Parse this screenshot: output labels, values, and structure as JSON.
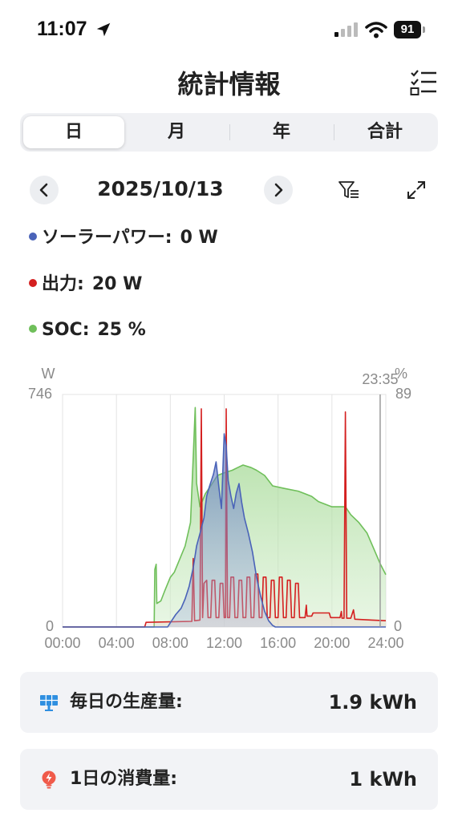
{
  "status_bar": {
    "time": "11:07",
    "battery": "91"
  },
  "header": {
    "title": "統計情報"
  },
  "tabs": [
    {
      "label": "日",
      "active": true
    },
    {
      "label": "月",
      "active": false
    },
    {
      "label": "年",
      "active": false
    },
    {
      "label": "合計",
      "active": false
    }
  ],
  "date_nav": {
    "date": "2025/10/13"
  },
  "legend": [
    {
      "label": "ソーラーパワー:",
      "value": "0 W",
      "color": "#4a63b8"
    },
    {
      "label": "出力:",
      "value": "20 W",
      "color": "#d42020"
    },
    {
      "label": "SOC:",
      "value": "25 %",
      "color": "#6fbf5a"
    }
  ],
  "chart_data": {
    "type": "area",
    "left_axis": {
      "unit": "W",
      "max_label": "746",
      "min_label": "0",
      "range": [
        0,
        746
      ]
    },
    "right_axis": {
      "unit": "%",
      "max_label": "89",
      "min_label": "0",
      "range": [
        0,
        89
      ]
    },
    "x_ticks": [
      "00:00",
      "04:00",
      "08:00",
      "12:00",
      "16:00",
      "20:00",
      "24:00"
    ],
    "x_range_hours": [
      0,
      24
    ],
    "cursor": {
      "label": "23:35",
      "hour": 23.58
    },
    "series": [
      {
        "name": "SOC",
        "axis": "right",
        "color": "#6fbf5a",
        "points": [
          [
            0,
            0
          ],
          [
            6.8,
            0
          ],
          [
            6.85,
            22
          ],
          [
            6.95,
            24
          ],
          [
            7.0,
            9
          ],
          [
            7.3,
            10
          ],
          [
            7.6,
            14
          ],
          [
            8.0,
            19
          ],
          [
            8.3,
            21
          ],
          [
            8.7,
            26
          ],
          [
            9.1,
            31
          ],
          [
            9.5,
            40
          ],
          [
            9.7,
            65
          ],
          [
            9.85,
            84
          ],
          [
            9.95,
            55
          ],
          [
            10.2,
            46
          ],
          [
            10.6,
            51
          ],
          [
            11.0,
            54
          ],
          [
            11.5,
            58
          ],
          [
            12.0,
            59
          ],
          [
            12.6,
            60
          ],
          [
            13.0,
            61
          ],
          [
            13.4,
            62
          ],
          [
            14.0,
            61
          ],
          [
            14.4,
            60
          ],
          [
            15.0,
            58
          ],
          [
            15.6,
            54
          ],
          [
            16.5,
            53
          ],
          [
            17.5,
            52
          ],
          [
            18.5,
            50
          ],
          [
            19.0,
            48
          ],
          [
            20.0,
            46
          ],
          [
            21.0,
            46
          ],
          [
            21.4,
            43
          ],
          [
            22.0,
            40
          ],
          [
            22.6,
            36
          ],
          [
            23.1,
            30
          ],
          [
            23.6,
            24
          ],
          [
            24,
            20
          ]
        ]
      },
      {
        "name": "ソーラーパワー",
        "axis": "left",
        "color": "#4a63b8",
        "points": [
          [
            0,
            0
          ],
          [
            7.8,
            0
          ],
          [
            8.1,
            20
          ],
          [
            8.4,
            40
          ],
          [
            8.8,
            60
          ],
          [
            9.1,
            90
          ],
          [
            9.4,
            130
          ],
          [
            9.7,
            190
          ],
          [
            9.95,
            260
          ],
          [
            10.2,
            300
          ],
          [
            10.5,
            350
          ],
          [
            10.7,
            420
          ],
          [
            10.9,
            450
          ],
          [
            11.2,
            490
          ],
          [
            11.4,
            530
          ],
          [
            11.6,
            450
          ],
          [
            11.8,
            380
          ],
          [
            12.0,
            620
          ],
          [
            12.15,
            580
          ],
          [
            12.3,
            470
          ],
          [
            12.5,
            420
          ],
          [
            12.7,
            380
          ],
          [
            12.9,
            430
          ],
          [
            13.1,
            460
          ],
          [
            13.3,
            400
          ],
          [
            13.5,
            350
          ],
          [
            13.8,
            300
          ],
          [
            14.1,
            240
          ],
          [
            14.4,
            160
          ],
          [
            14.7,
            100
          ],
          [
            15.0,
            50
          ],
          [
            15.3,
            20
          ],
          [
            15.6,
            5
          ],
          [
            15.8,
            0
          ],
          [
            24,
            0
          ]
        ]
      },
      {
        "name": "出力",
        "axis": "left",
        "color": "#d42020",
        "points": [
          [
            0,
            0
          ],
          [
            6.1,
            0
          ],
          [
            6.2,
            15
          ],
          [
            9.6,
            18
          ],
          [
            9.7,
            220
          ],
          [
            9.8,
            20
          ],
          [
            10.2,
            22
          ],
          [
            10.3,
            700
          ],
          [
            10.4,
            30
          ],
          [
            10.5,
            140
          ],
          [
            10.7,
            150
          ],
          [
            10.8,
            30
          ],
          [
            11.0,
            30
          ],
          [
            11.1,
            150
          ],
          [
            11.3,
            150
          ],
          [
            11.4,
            30
          ],
          [
            11.6,
            30
          ],
          [
            11.7,
            140
          ],
          [
            11.9,
            140
          ],
          [
            12.0,
            30
          ],
          [
            12.1,
            30
          ],
          [
            12.15,
            700
          ],
          [
            12.25,
            30
          ],
          [
            12.4,
            30
          ],
          [
            12.5,
            160
          ],
          [
            12.7,
            160
          ],
          [
            12.8,
            30
          ],
          [
            13.0,
            30
          ],
          [
            13.1,
            150
          ],
          [
            13.3,
            150
          ],
          [
            13.4,
            30
          ],
          [
            13.6,
            30
          ],
          [
            13.7,
            160
          ],
          [
            13.9,
            160
          ],
          [
            14.0,
            30
          ],
          [
            14.2,
            30
          ],
          [
            14.3,
            170
          ],
          [
            14.5,
            170
          ],
          [
            14.6,
            30
          ],
          [
            14.8,
            30
          ],
          [
            14.9,
            160
          ],
          [
            15.1,
            160
          ],
          [
            15.2,
            30
          ],
          [
            15.4,
            30
          ],
          [
            15.5,
            150
          ],
          [
            15.7,
            150
          ],
          [
            15.8,
            30
          ],
          [
            16.0,
            30
          ],
          [
            16.1,
            160
          ],
          [
            16.3,
            160
          ],
          [
            16.4,
            30
          ],
          [
            16.6,
            30
          ],
          [
            16.7,
            150
          ],
          [
            16.9,
            150
          ],
          [
            17.0,
            30
          ],
          [
            17.2,
            30
          ],
          [
            17.3,
            140
          ],
          [
            17.5,
            140
          ],
          [
            17.6,
            30
          ],
          [
            18.0,
            30
          ],
          [
            18.1,
            70
          ],
          [
            18.15,
            35
          ],
          [
            18.5,
            35
          ],
          [
            18.6,
            45
          ],
          [
            19.8,
            45
          ],
          [
            19.9,
            30
          ],
          [
            20.6,
            30
          ],
          [
            20.7,
            50
          ],
          [
            20.75,
            28
          ],
          [
            20.9,
            28
          ],
          [
            21.0,
            690
          ],
          [
            21.1,
            28
          ],
          [
            21.4,
            28
          ],
          [
            21.6,
            55
          ],
          [
            21.7,
            25
          ],
          [
            23.0,
            22
          ],
          [
            24,
            20
          ]
        ]
      }
    ]
  },
  "summary": [
    {
      "label": "毎日の生産量:",
      "value": "1.9 kWh"
    },
    {
      "label": "1日の消費量:",
      "value": "1 kWh"
    }
  ]
}
